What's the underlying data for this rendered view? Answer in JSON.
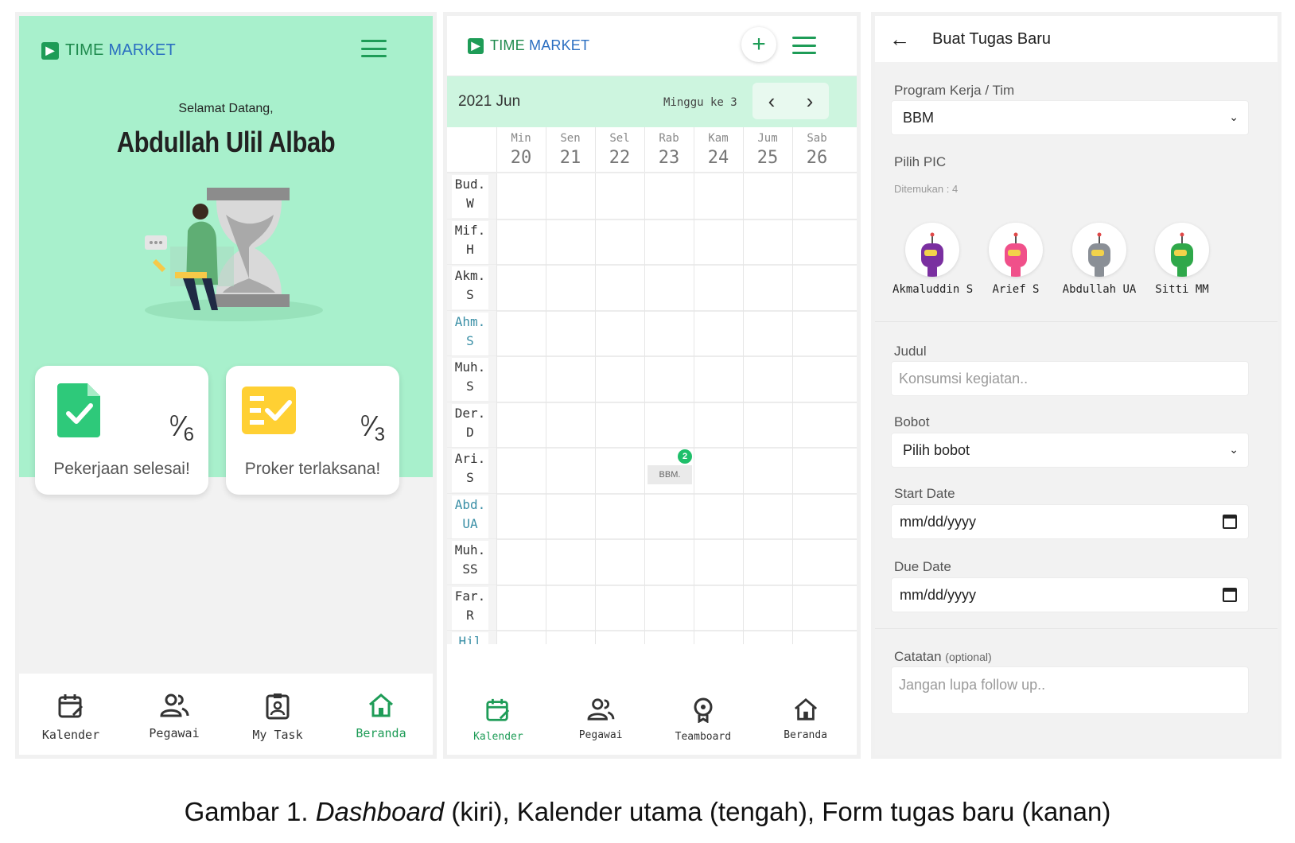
{
  "dashboard": {
    "brand": {
      "part1": "TIME",
      "part2": "MARKET"
    },
    "welcome": "Selamat Datang,",
    "username": "Abdullah Ulil Albab",
    "cards": [
      {
        "done": "0",
        "total": "6",
        "label": "Pekerjaan selesai!",
        "icon": "document-check-icon",
        "color": "#2ec97a"
      },
      {
        "done": "0",
        "total": "3",
        "label": "Proker terlaksana!",
        "icon": "checklist-icon",
        "color": "#ffd033"
      }
    ],
    "nav": [
      {
        "label": "Kalender",
        "icon": "calendar-icon"
      },
      {
        "label": "Pegawai",
        "icon": "people-icon"
      },
      {
        "label": "My Task",
        "icon": "id-card-icon"
      },
      {
        "label": "Beranda",
        "icon": "home-icon",
        "active": true
      }
    ]
  },
  "calendar": {
    "brand": {
      "part1": "TIME",
      "part2": "MARKET"
    },
    "month": "2021 Jun",
    "week": "Minggu ke 3",
    "days": [
      {
        "name": "Min",
        "date": "20"
      },
      {
        "name": "Sen",
        "date": "21"
      },
      {
        "name": "Sel",
        "date": "22"
      },
      {
        "name": "Rab",
        "date": "23"
      },
      {
        "name": "Kam",
        "date": "24"
      },
      {
        "name": "Jum",
        "date": "25"
      },
      {
        "name": "Sab",
        "date": "26"
      }
    ],
    "people": [
      {
        "l1": "Bud.",
        "l2": "W"
      },
      {
        "l1": "Mif.",
        "l2": "H"
      },
      {
        "l1": "Akm.",
        "l2": "S"
      },
      {
        "l1": "Ahm.",
        "l2": "S",
        "teal": true
      },
      {
        "l1": "Muh.",
        "l2": "S"
      },
      {
        "l1": "Der.",
        "l2": "D"
      },
      {
        "l1": "Ari.",
        "l2": "S"
      },
      {
        "l1": "Abd.",
        "l2": "UA",
        "teal": true
      },
      {
        "l1": "Muh.",
        "l2": "SS"
      },
      {
        "l1": "Far.",
        "l2": "R"
      },
      {
        "l1": "Hil",
        "l2": "",
        "teal": true
      }
    ],
    "event": {
      "label": "BBM.",
      "count": "2"
    },
    "nav": [
      {
        "label": "Kalender",
        "icon": "calendar-icon",
        "active": true
      },
      {
        "label": "Pegawai",
        "icon": "people-icon"
      },
      {
        "label": "Teamboard",
        "icon": "teamboard-icon"
      },
      {
        "label": "Beranda",
        "icon": "home-icon"
      }
    ]
  },
  "form": {
    "title": "Buat Tugas Baru",
    "program_label": "Program Kerja / Tim",
    "program_value": "BBM",
    "pic_label": "Pilih PIC",
    "found": "Ditemukan : 4",
    "pics": [
      {
        "name": "Akmaluddin S",
        "color": "#7a2fa0"
      },
      {
        "name": "Arief S",
        "color": "#f0508a"
      },
      {
        "name": "Abdullah UA",
        "color": "#8a8f96"
      },
      {
        "name": "Sitti MM",
        "color": "#2fa84a"
      }
    ],
    "judul_label": "Judul",
    "judul_placeholder": "Konsumsi kegiatan..",
    "bobot_label": "Bobot",
    "bobot_value": "Pilih bobot",
    "start_label": "Start Date",
    "start_value": "mm/dd/yyyy",
    "due_label": "Due Date",
    "due_value": "mm/dd/yyyy",
    "catatan_label": "Catatan",
    "catatan_optional": "(optional)",
    "catatan_placeholder": "Jangan lupa follow up.."
  },
  "caption": {
    "prefix": "Gambar 1. ",
    "emph": "Dashboard",
    "rest": " (kiri), Kalender utama (tengah), Form tugas baru (kanan)"
  }
}
